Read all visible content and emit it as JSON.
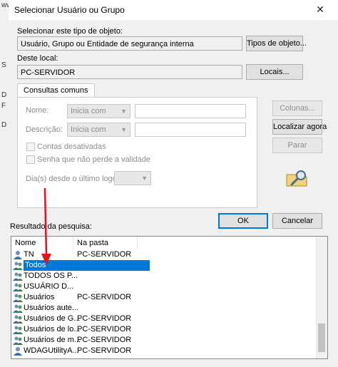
{
  "background_window": {
    "fragments": [
      "ww",
      "S",
      "D",
      "F",
      "D"
    ]
  },
  "dialog": {
    "title": "Selecionar Usuário ou Grupo",
    "close_glyph": "✕"
  },
  "object_type": {
    "label": "Selecionar este tipo de objeto:",
    "value": "Usuário, Grupo ou Entidade de segurança interna",
    "button": "Tipos de objeto..."
  },
  "location": {
    "label": "Deste local:",
    "value": "PC-SERVIDOR",
    "button": "Locais..."
  },
  "common_queries": {
    "tab": "Consultas comuns",
    "name_label": "Nome:",
    "name_mode": "Inicia com",
    "description_label": "Descrição:",
    "description_mode": "Inicia com",
    "disabled_accounts": "Contas desativadas",
    "non_expiring_password": "Senha que não perde a validade",
    "days_since_logon": "Dia(s) desde o último logon:",
    "columns_button": "Colunas...",
    "find_now_button": "Localizar agora",
    "stop_button": "Parar"
  },
  "actions": {
    "ok": "OK",
    "cancel": "Cancelar"
  },
  "results": {
    "label": "Resultado da pesquisa:",
    "columns": [
      "Nome",
      "Na pasta"
    ],
    "rows": [
      {
        "name": "TN",
        "folder": "PC-SERVIDOR",
        "icon": "user-icon"
      },
      {
        "name": "Todos",
        "folder": "",
        "icon": "group-icon"
      },
      {
        "name": "TODOS OS P...",
        "folder": "",
        "icon": "group-icon"
      },
      {
        "name": "USUÁRIO D...",
        "folder": "",
        "icon": "group-icon"
      },
      {
        "name": "Usuários",
        "folder": "PC-SERVIDOR",
        "icon": "group-icon"
      },
      {
        "name": "Usuários aute...",
        "folder": "",
        "icon": "group-icon"
      },
      {
        "name": "Usuários de G...",
        "folder": "PC-SERVIDOR",
        "icon": "group-icon"
      },
      {
        "name": "Usuários de lo...",
        "folder": "PC-SERVIDOR",
        "icon": "group-icon"
      },
      {
        "name": "Usuários de m...",
        "folder": "PC-SERVIDOR",
        "icon": "group-icon"
      },
      {
        "name": "WDAGUtilityA...",
        "folder": "PC-SERVIDOR",
        "icon": "user-icon"
      }
    ]
  },
  "colors": {
    "accent": "#0078d7",
    "annotation": "#e8101c"
  }
}
